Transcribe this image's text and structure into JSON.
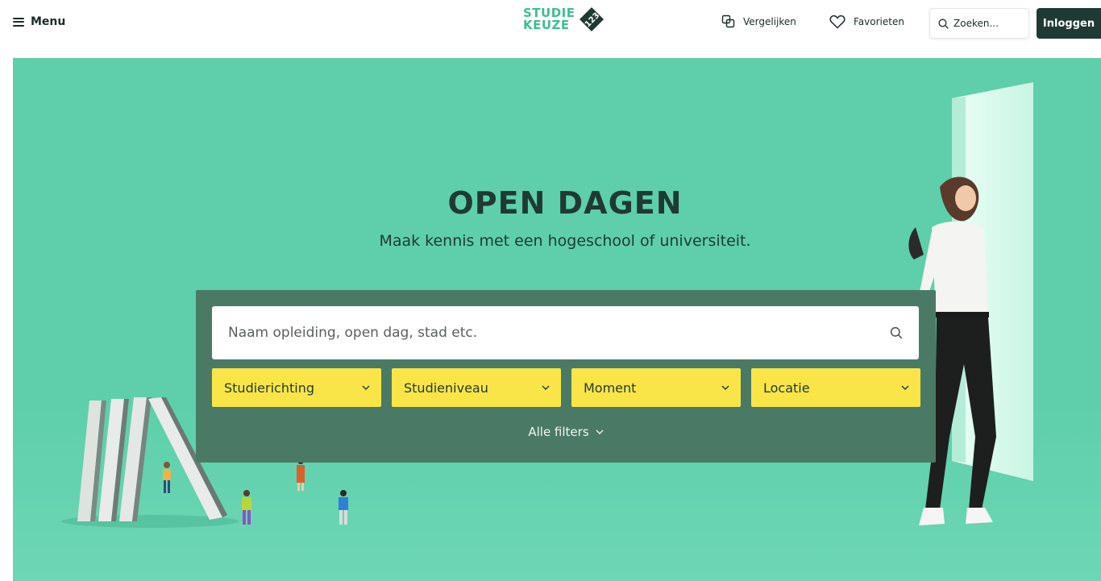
{
  "header": {
    "menu_label": "Menu",
    "logo": {
      "line1": "STUDIE",
      "line2": "KEUZE",
      "badge": "123"
    },
    "compare_label": "Vergelijken",
    "favorites_label": "Favorieten",
    "search_placeholder": "Zoeken...",
    "login_label": "Inloggen"
  },
  "hero": {
    "title": "OPEN DAGEN",
    "subtitle": "Maak kennis met een hogeschool of universiteit.",
    "search_placeholder": "Naam opleiding, open dag, stad etc.",
    "filters": [
      {
        "label": "Studierichting"
      },
      {
        "label": "Studieniveau"
      },
      {
        "label": "Moment"
      },
      {
        "label": "Locatie"
      }
    ],
    "all_filters_label": "Alle filters"
  },
  "icons": {
    "menu": "hamburger-icon",
    "compare": "compare-icon",
    "favorites": "heart-icon",
    "search": "search-icon",
    "dropdown": "chevron-down-icon"
  },
  "colors": {
    "brand_green": "#3cbf8f",
    "hero_bg": "#5ecfaa",
    "panel_bg": "#4a7a65",
    "filter_bg": "#f9e547",
    "dark": "#1f3a33"
  }
}
